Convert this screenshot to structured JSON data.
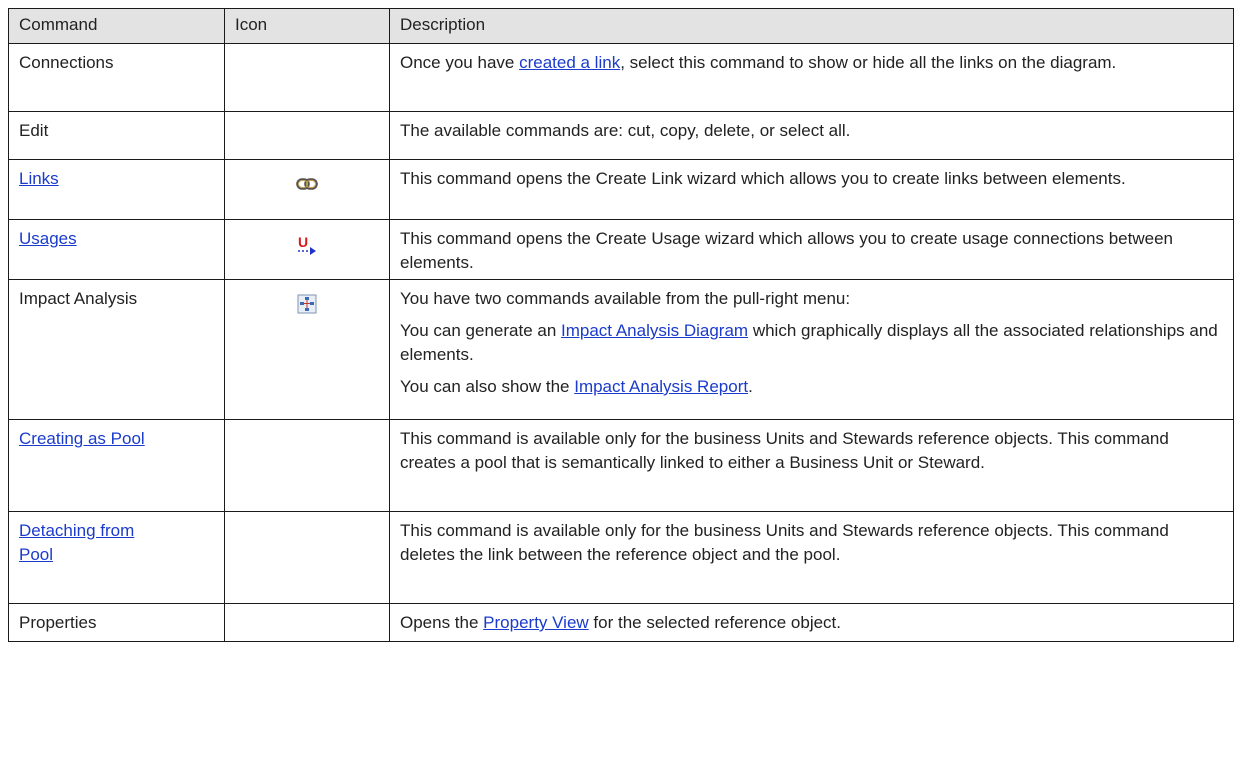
{
  "headers": {
    "command": "Command",
    "icon": "Icon",
    "description": "Description"
  },
  "rows": {
    "connections": {
      "command": "Connections",
      "desc_pre": "Once you have ",
      "desc_link": "created a link",
      "desc_post": ", select this command to show or hide all the links on the diagram."
    },
    "edit": {
      "command": "Edit",
      "desc": "The available commands are: cut, copy, delete, or select all."
    },
    "links": {
      "command": "Links",
      "icon": "link-chain-icon",
      "desc": "This command opens the Create Link wizard which allows you to create links between elements."
    },
    "usages": {
      "command": "Usages",
      "icon": "usage-arrow-icon",
      "icon_letter": "U",
      "desc": "This command opens the Create Usage wizard which allows you to create usage connections between elements."
    },
    "impact": {
      "command": "Impact Analysis",
      "icon": "impact-analysis-icon",
      "p1": "You have two commands available from the pull-right menu:",
      "p2_pre": "You can generate an ",
      "p2_link1": "Impact Analysis ",
      "p2_link2": "Diagram",
      "p2_post": " which graphically displays all the associated relationships and elements.",
      "p3_pre": "You can also show the ",
      "p3_link1": "Impact Analysis ",
      "p3_link2": "Report",
      "p3_post": "."
    },
    "pool": {
      "command": "Creating as Pool",
      "desc": "This command is available only for the business Units and Stewards reference objects. This command creates a pool that is semantically linked to either a Business Unit or Steward."
    },
    "detach": {
      "command_line1": "Detaching from ",
      "command_line2": "Pool",
      "desc": "This command is available only for the business Units and Stewards reference objects. This command deletes the link between the reference object and the pool."
    },
    "properties": {
      "command": "Properties",
      "desc_pre": "Opens the ",
      "desc_link": "Property View",
      "desc_post": " for the selected reference object."
    }
  },
  "colors": {
    "link": "#1a3bcc",
    "header_bg": "#e3e3e3",
    "border": "#1a1a1a"
  }
}
